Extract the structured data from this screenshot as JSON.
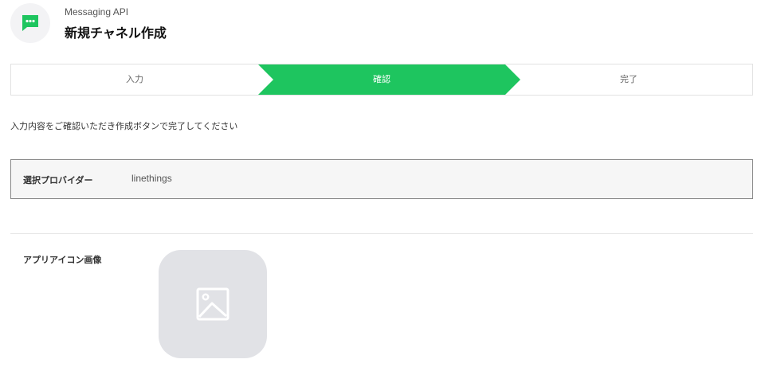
{
  "header": {
    "service_name": "Messaging API",
    "page_title": "新規チャネル作成",
    "app_icon": "chat-bubble-icon",
    "app_icon_color": "#1ec55f"
  },
  "stepper": {
    "active_color": "#1ec55f",
    "steps": [
      {
        "label": "入力",
        "active": false
      },
      {
        "label": "確認",
        "active": true
      },
      {
        "label": "完了",
        "active": false
      }
    ]
  },
  "instruction": "入力内容をご確認いただき作成ボタンで完了してください",
  "provider": {
    "label": "選択プロバイダー",
    "value": "linethings"
  },
  "app_icon_section": {
    "label": "アプリアイコン画像",
    "placeholder_icon": "image-placeholder-icon"
  }
}
